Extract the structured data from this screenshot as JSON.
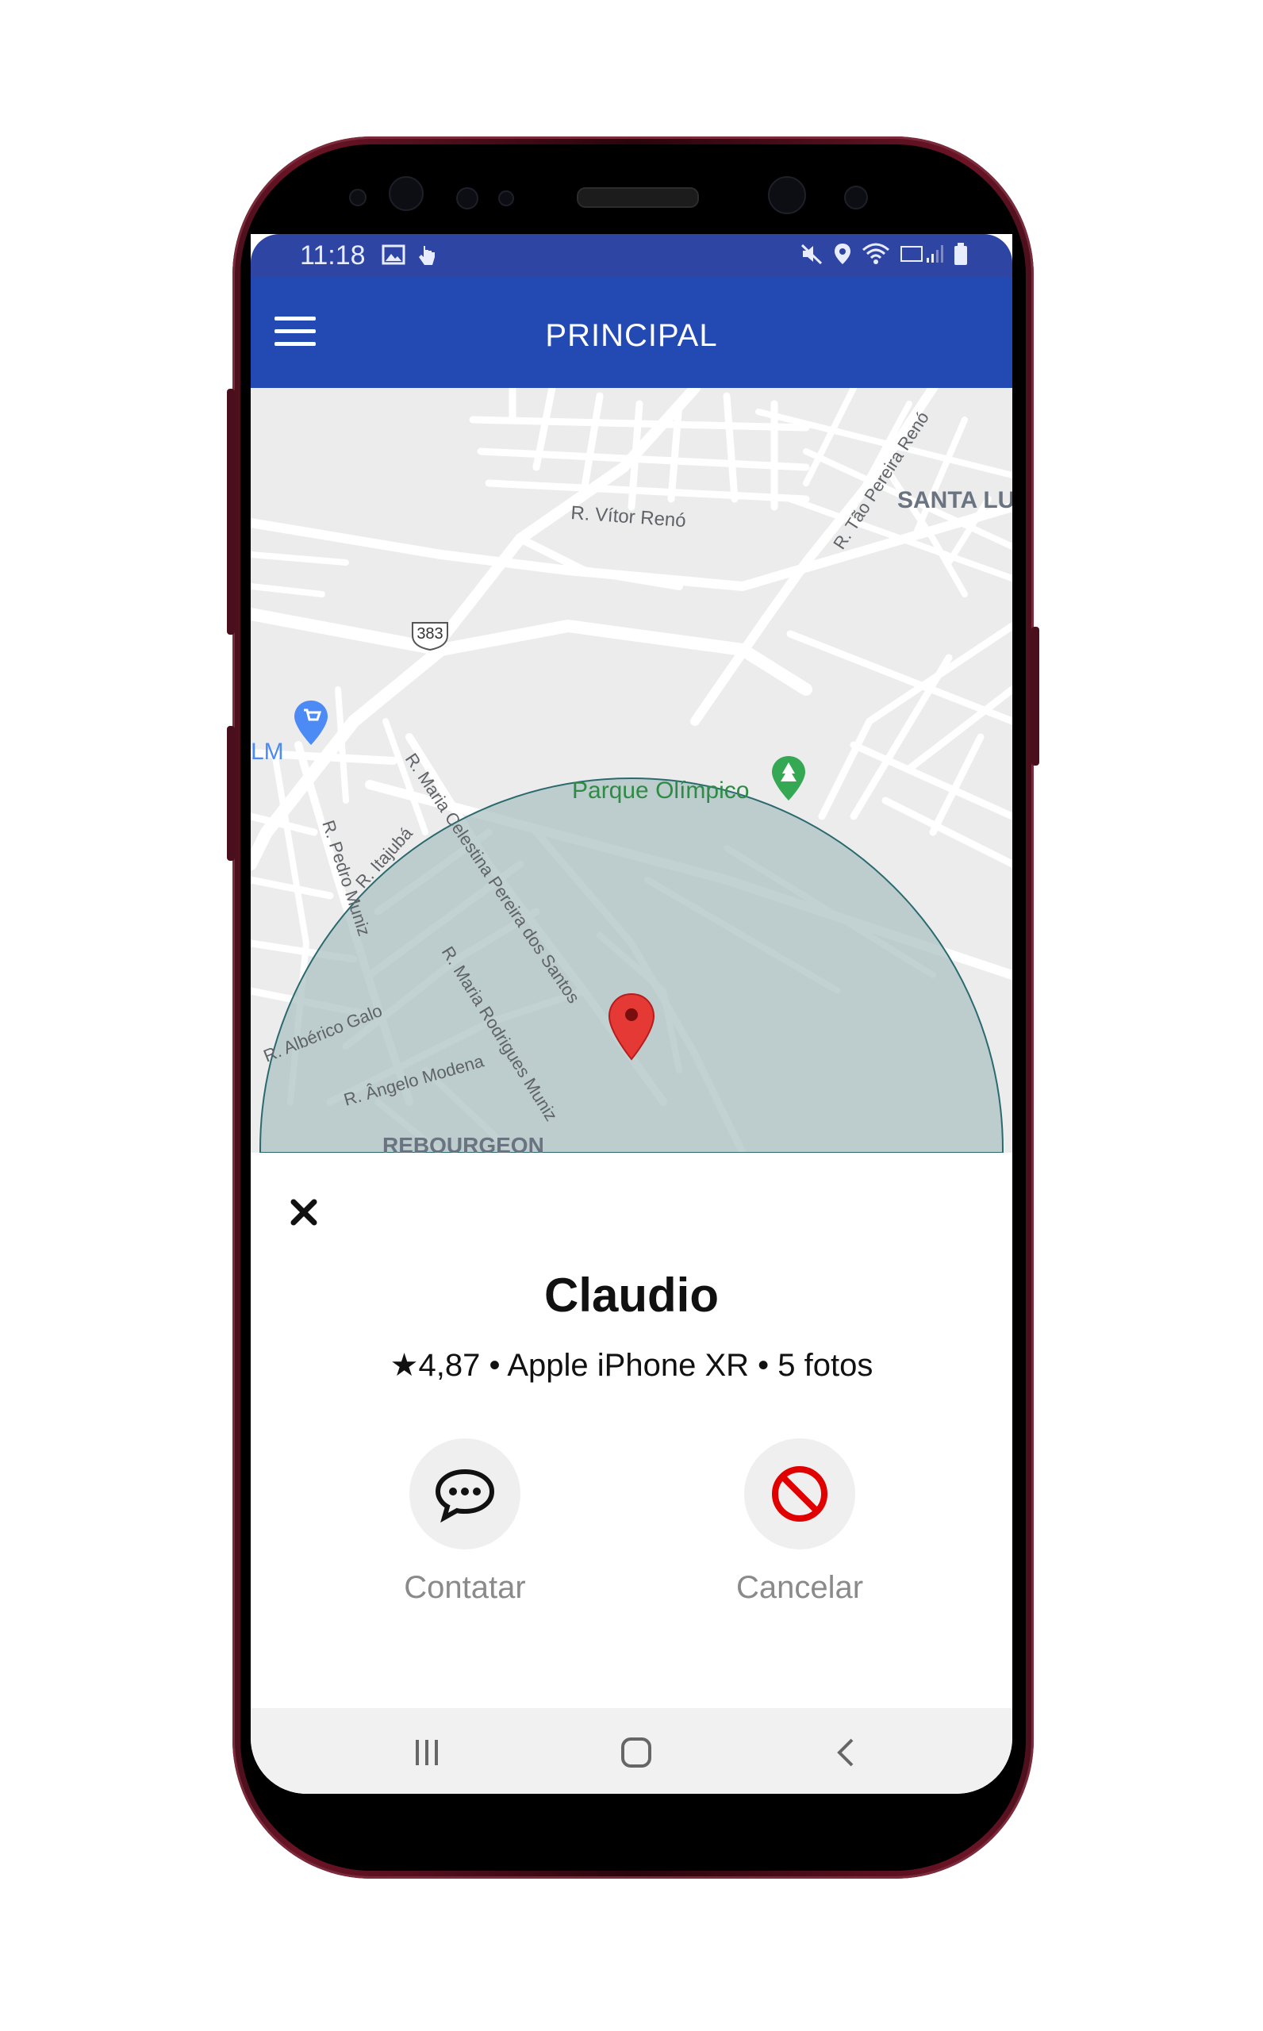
{
  "status_bar": {
    "time": "11:18"
  },
  "app_bar": {
    "title": "PRINCIPAL"
  },
  "map": {
    "labels": {
      "vitor_reno": "R. Vítor Renó",
      "tao_pereira": "R. Tão Pereira Renó",
      "santa_lu": "SANTA LU",
      "route_383": "383",
      "lm": "LM",
      "parque": "Parque Olímpico",
      "maria_celestina": "R. Maria Celestina Pereira dos Santos",
      "itajuba": "R. Itajubá",
      "pedro_muniz": "R. Pedro Muniz",
      "maria_rodrigues": "R. Maria Rodrigues Muniz",
      "alberico": "R. Albérico Galo",
      "angelo": "R. Ângelo Modena",
      "rebourgeon": "REBOURGEON"
    }
  },
  "sheet": {
    "driver_name": "Claudio",
    "driver_info": "★4,87 • Apple iPhone XR • 5 fotos",
    "contact_label": "Contatar",
    "cancel_label": "Cancelar"
  },
  "colors": {
    "status_bar": "#2f45a3",
    "app_bar": "#2349b3",
    "radius_fill": "#b8cacb",
    "pin": "#e53935",
    "cancel_icon": "#e10000"
  }
}
